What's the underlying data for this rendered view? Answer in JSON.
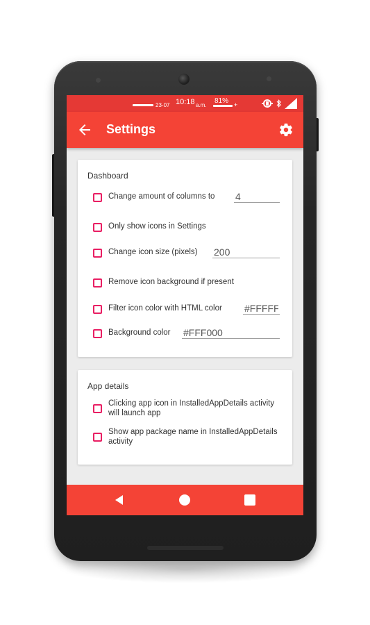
{
  "status_bar": {
    "date": "23-07",
    "time": "10:18",
    "ampm": "a.m.",
    "battery": "81%",
    "battery_sign": "+"
  },
  "toolbar": {
    "title": "Settings",
    "back_icon": "arrow-back-icon",
    "settings_icon": "gear-icon"
  },
  "dashboard": {
    "header": "Dashboard",
    "items": [
      {
        "label": "Change amount of columns to",
        "checked": false,
        "value": "4"
      },
      {
        "label": "Only show icons in Settings",
        "checked": false
      },
      {
        "label": "Change icon size (pixels)",
        "checked": false,
        "value": "200"
      },
      {
        "label": "Remove icon background if present",
        "checked": false
      },
      {
        "label": "Filter icon color with HTML color",
        "checked": false,
        "value": "#FFFFFF"
      },
      {
        "label": "Background color",
        "checked": false,
        "value": "#FFF000"
      }
    ]
  },
  "app_details": {
    "header": "App details",
    "items": [
      {
        "label": "Clicking app icon in InstalledAppDetails activity will launch app",
        "checked": false
      },
      {
        "label": "Show app package name in InstalledAppDetails activity",
        "checked": false
      }
    ]
  },
  "nav_bar": {
    "back_icon": "nav-back-icon",
    "home_icon": "nav-home-icon",
    "recents_icon": "nav-recents-icon"
  },
  "colors": {
    "accent": "#f44336",
    "status_bar": "#e53935",
    "checkbox": "#e91e63",
    "background": "#ececec"
  }
}
